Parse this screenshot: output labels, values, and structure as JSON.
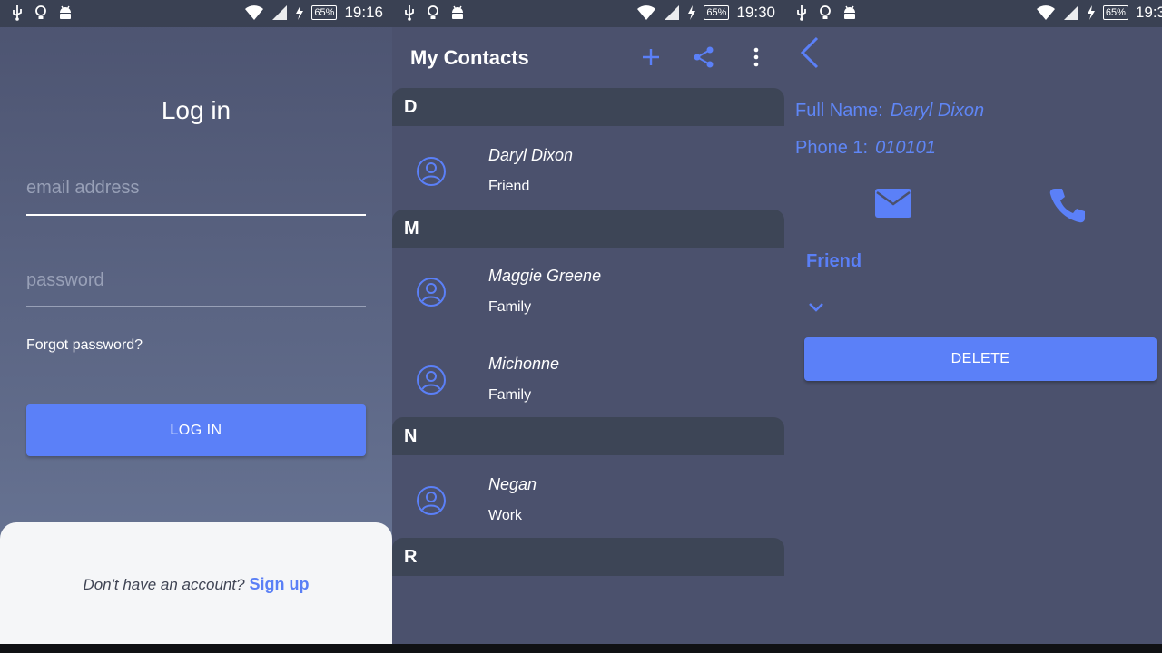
{
  "colors": {
    "accent": "#5b80f8",
    "statusbar": "#3a4153",
    "list_bg": "#4b516d",
    "section_bg": "#3d4556"
  },
  "status_bars": [
    {
      "time": "19:16",
      "battery": "65%"
    },
    {
      "time": "19:30",
      "battery": "65%"
    },
    {
      "time": "19:3",
      "battery": "65%"
    }
  ],
  "login": {
    "title": "Log in",
    "email_placeholder": "email address",
    "password_placeholder": "password",
    "forgot_label": "Forgot password?",
    "login_button": "LOG IN",
    "signup_prompt": "Don't have an account?",
    "signup_link": "Sign up"
  },
  "contacts": {
    "title": "My Contacts",
    "actions": [
      "plus-icon",
      "share-icon",
      "more-vert-icon"
    ],
    "sections": [
      {
        "letter": "D",
        "items": [
          {
            "name": "Daryl Dixon",
            "group": "Friend"
          }
        ]
      },
      {
        "letter": "M",
        "items": [
          {
            "name": "Maggie Greene",
            "group": "Family"
          },
          {
            "name": "Michonne",
            "group": "Family"
          }
        ]
      },
      {
        "letter": "N",
        "items": [
          {
            "name": "Negan",
            "group": "Work"
          }
        ]
      },
      {
        "letter": "R",
        "items": []
      }
    ]
  },
  "detail": {
    "full_name_label": "Full Name:",
    "full_name_value": "Daryl Dixon",
    "phone_label": "Phone 1:",
    "phone_value": "010101",
    "group": "Friend",
    "delete_button": "DELETE"
  }
}
